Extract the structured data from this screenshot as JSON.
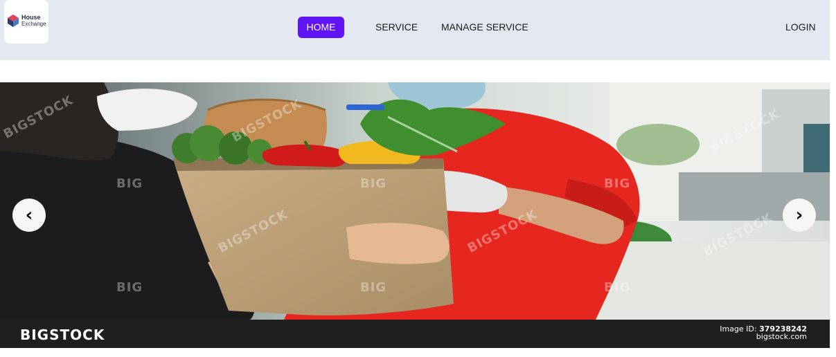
{
  "brand": {
    "logo_line1": "House",
    "logo_line2": "Exchange"
  },
  "nav": {
    "home": "HOME",
    "service": "SERVICE",
    "manage_service": "MANAGE SERVICE",
    "login": "LOGIN"
  },
  "carousel": {
    "prev_label": "‹",
    "next_label": "›",
    "watermark_brand": "BIGSTOCK",
    "watermark_short": "BIG",
    "image_id_label": "Image ID:",
    "image_id_value": "379238242",
    "image_site": "bigstock.com"
  },
  "colors": {
    "nav_bg": "#e3e8f1",
    "active_tab": "#6115f5",
    "stock_bar": "#1f1f1f"
  }
}
